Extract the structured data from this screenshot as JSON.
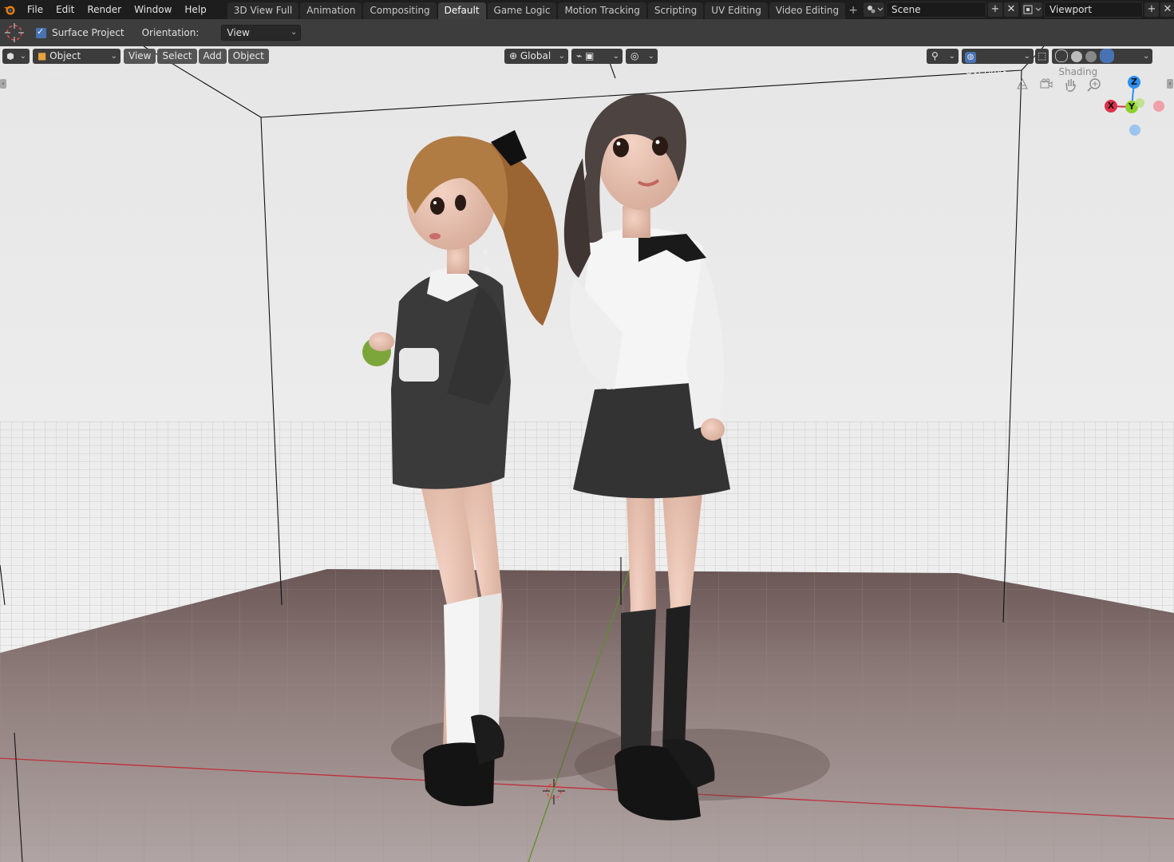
{
  "topbar": {
    "menu": [
      "File",
      "Edit",
      "Render",
      "Window",
      "Help"
    ],
    "workspace_tabs": [
      "3D View Full",
      "Animation",
      "Compositing",
      "Default",
      "Game Logic",
      "Motion Tracking",
      "Scripting",
      "UV Editing",
      "Video Editing"
    ],
    "active_tab": "Default",
    "add_tab": "+",
    "scene": {
      "value": "Scene",
      "add": "+",
      "close": "✕"
    },
    "view_layer": {
      "value": "Viewport",
      "add": "+",
      "close": "✕"
    }
  },
  "tool_settings": {
    "surface_project_label": "Surface Project",
    "surface_project_checked": true,
    "orientation_label": "Orientation:",
    "orientation_value": "View"
  },
  "viewport_header": {
    "mode": "Object Mode",
    "menu": [
      "View",
      "Select",
      "Add",
      "Object"
    ],
    "transform_orientation": "Global",
    "overlays_label": "Overlays",
    "shading_label": "Shading"
  },
  "gizmo": {
    "z": "Z",
    "y": "Y",
    "x": "X"
  },
  "colors": {
    "accent": "#4772b3",
    "axis_x": "#e0304a",
    "axis_y": "#8cd12a",
    "axis_z": "#2d8ff0",
    "floor": "#8a7876",
    "grid_bg": "#e9e9e9"
  },
  "icons": [
    "blender-logo-icon",
    "cursor-tool-icon",
    "object-mode-cube-icon",
    "pivot-icon",
    "snap-icon",
    "proportional-icon",
    "visibility-icon",
    "overlay-globe-icon",
    "xray-icon",
    "wireframe-shading-icon",
    "solid-shading-icon",
    "material-shading-icon",
    "rendered-shading-icon",
    "camera-view-icon",
    "grid-toggle-icon",
    "pan-hand-icon",
    "zoom-icon",
    "3d-cursor-icon"
  ]
}
